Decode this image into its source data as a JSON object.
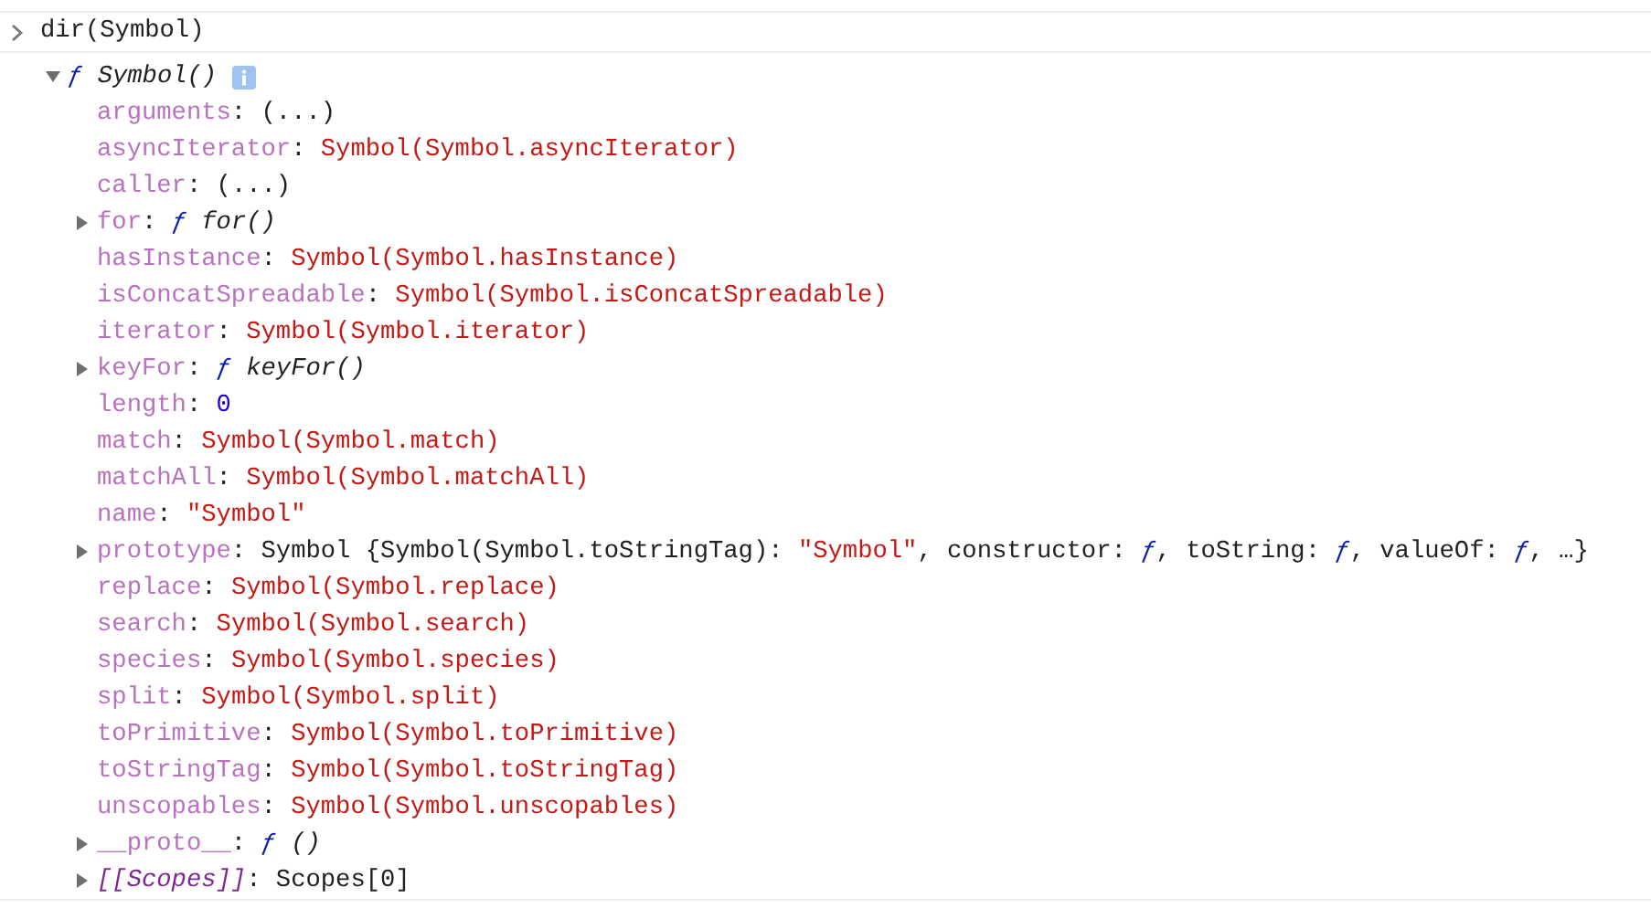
{
  "input": {
    "text": "dir(Symbol)"
  },
  "root": {
    "expanded": true,
    "parts": [
      {
        "kind": "fsign",
        "text": "ƒ "
      },
      {
        "kind": "fname",
        "text": "Symbol()"
      }
    ],
    "children": [
      {
        "kind": "leaf",
        "parts": [
          {
            "kind": "key",
            "text": "arguments"
          },
          {
            "kind": "punct",
            "text": ": "
          },
          {
            "kind": "plain",
            "text": "(...)"
          }
        ]
      },
      {
        "kind": "leaf",
        "parts": [
          {
            "kind": "key",
            "text": "asyncIterator"
          },
          {
            "kind": "punct",
            "text": ": "
          },
          {
            "kind": "symbol",
            "text": "Symbol(Symbol.asyncIterator)"
          }
        ]
      },
      {
        "kind": "leaf",
        "parts": [
          {
            "kind": "key",
            "text": "caller"
          },
          {
            "kind": "punct",
            "text": ": "
          },
          {
            "kind": "plain",
            "text": "(...)"
          }
        ]
      },
      {
        "kind": "node",
        "expanded": false,
        "parts": [
          {
            "kind": "key",
            "text": "for"
          },
          {
            "kind": "punct",
            "text": ": "
          },
          {
            "kind": "fsign",
            "text": "ƒ "
          },
          {
            "kind": "fname",
            "text": "for()"
          }
        ]
      },
      {
        "kind": "leaf",
        "parts": [
          {
            "kind": "key",
            "text": "hasInstance"
          },
          {
            "kind": "punct",
            "text": ": "
          },
          {
            "kind": "symbol",
            "text": "Symbol(Symbol.hasInstance)"
          }
        ]
      },
      {
        "kind": "leaf",
        "parts": [
          {
            "kind": "key",
            "text": "isConcatSpreadable"
          },
          {
            "kind": "punct",
            "text": ": "
          },
          {
            "kind": "symbol",
            "text": "Symbol(Symbol.isConcatSpreadable)"
          }
        ]
      },
      {
        "kind": "leaf",
        "parts": [
          {
            "kind": "key",
            "text": "iterator"
          },
          {
            "kind": "punct",
            "text": ": "
          },
          {
            "kind": "symbol",
            "text": "Symbol(Symbol.iterator)"
          }
        ]
      },
      {
        "kind": "node",
        "expanded": false,
        "parts": [
          {
            "kind": "key",
            "text": "keyFor"
          },
          {
            "kind": "punct",
            "text": ": "
          },
          {
            "kind": "fsign",
            "text": "ƒ "
          },
          {
            "kind": "fname",
            "text": "keyFor()"
          }
        ]
      },
      {
        "kind": "leaf",
        "parts": [
          {
            "kind": "key",
            "text": "length"
          },
          {
            "kind": "punct",
            "text": ": "
          },
          {
            "kind": "number",
            "text": "0"
          }
        ]
      },
      {
        "kind": "leaf",
        "parts": [
          {
            "kind": "key",
            "text": "match"
          },
          {
            "kind": "punct",
            "text": ": "
          },
          {
            "kind": "symbol",
            "text": "Symbol(Symbol.match)"
          }
        ]
      },
      {
        "kind": "leaf",
        "parts": [
          {
            "kind": "key",
            "text": "matchAll"
          },
          {
            "kind": "punct",
            "text": ": "
          },
          {
            "kind": "symbol",
            "text": "Symbol(Symbol.matchAll)"
          }
        ]
      },
      {
        "kind": "leaf",
        "parts": [
          {
            "kind": "key",
            "text": "name"
          },
          {
            "kind": "punct",
            "text": ": "
          },
          {
            "kind": "string",
            "text": "\"Symbol\""
          }
        ]
      },
      {
        "kind": "node",
        "expanded": false,
        "parts": [
          {
            "kind": "key",
            "text": "prototype"
          },
          {
            "kind": "punct",
            "text": ": "
          },
          {
            "kind": "plain",
            "text": "Symbol {Symbol(Symbol.toStringTag): "
          },
          {
            "kind": "string",
            "text": "\"Symbol\""
          },
          {
            "kind": "plain",
            "text": ", constructor: "
          },
          {
            "kind": "fsign",
            "text": "ƒ"
          },
          {
            "kind": "plain",
            "text": ", toString: "
          },
          {
            "kind": "fsign",
            "text": "ƒ"
          },
          {
            "kind": "plain",
            "text": ", valueOf: "
          },
          {
            "kind": "fsign",
            "text": "ƒ"
          },
          {
            "kind": "plain",
            "text": ", …}"
          }
        ]
      },
      {
        "kind": "leaf",
        "parts": [
          {
            "kind": "key",
            "text": "replace"
          },
          {
            "kind": "punct",
            "text": ": "
          },
          {
            "kind": "symbol",
            "text": "Symbol(Symbol.replace)"
          }
        ]
      },
      {
        "kind": "leaf",
        "parts": [
          {
            "kind": "key",
            "text": "search"
          },
          {
            "kind": "punct",
            "text": ": "
          },
          {
            "kind": "symbol",
            "text": "Symbol(Symbol.search)"
          }
        ]
      },
      {
        "kind": "leaf",
        "parts": [
          {
            "kind": "key",
            "text": "species"
          },
          {
            "kind": "punct",
            "text": ": "
          },
          {
            "kind": "symbol",
            "text": "Symbol(Symbol.species)"
          }
        ]
      },
      {
        "kind": "leaf",
        "parts": [
          {
            "kind": "key",
            "text": "split"
          },
          {
            "kind": "punct",
            "text": ": "
          },
          {
            "kind": "symbol",
            "text": "Symbol(Symbol.split)"
          }
        ]
      },
      {
        "kind": "leaf",
        "parts": [
          {
            "kind": "key",
            "text": "toPrimitive"
          },
          {
            "kind": "punct",
            "text": ": "
          },
          {
            "kind": "symbol",
            "text": "Symbol(Symbol.toPrimitive)"
          }
        ]
      },
      {
        "kind": "leaf",
        "parts": [
          {
            "kind": "key",
            "text": "toStringTag"
          },
          {
            "kind": "punct",
            "text": ": "
          },
          {
            "kind": "symbol",
            "text": "Symbol(Symbol.toStringTag)"
          }
        ]
      },
      {
        "kind": "leaf",
        "parts": [
          {
            "kind": "key",
            "text": "unscopables"
          },
          {
            "kind": "punct",
            "text": ": "
          },
          {
            "kind": "symbol",
            "text": "Symbol(Symbol.unscopables)"
          }
        ]
      },
      {
        "kind": "node",
        "expanded": false,
        "parts": [
          {
            "kind": "key",
            "text": "__proto__"
          },
          {
            "kind": "punct",
            "text": ": "
          },
          {
            "kind": "fsign",
            "text": "ƒ "
          },
          {
            "kind": "fname",
            "text": "()"
          }
        ]
      },
      {
        "kind": "node",
        "expanded": false,
        "parts": [
          {
            "kind": "internal",
            "text": "[[Scopes]]"
          },
          {
            "kind": "punct",
            "text": ": "
          },
          {
            "kind": "plain",
            "text": "Scopes[0]"
          }
        ]
      }
    ]
  }
}
